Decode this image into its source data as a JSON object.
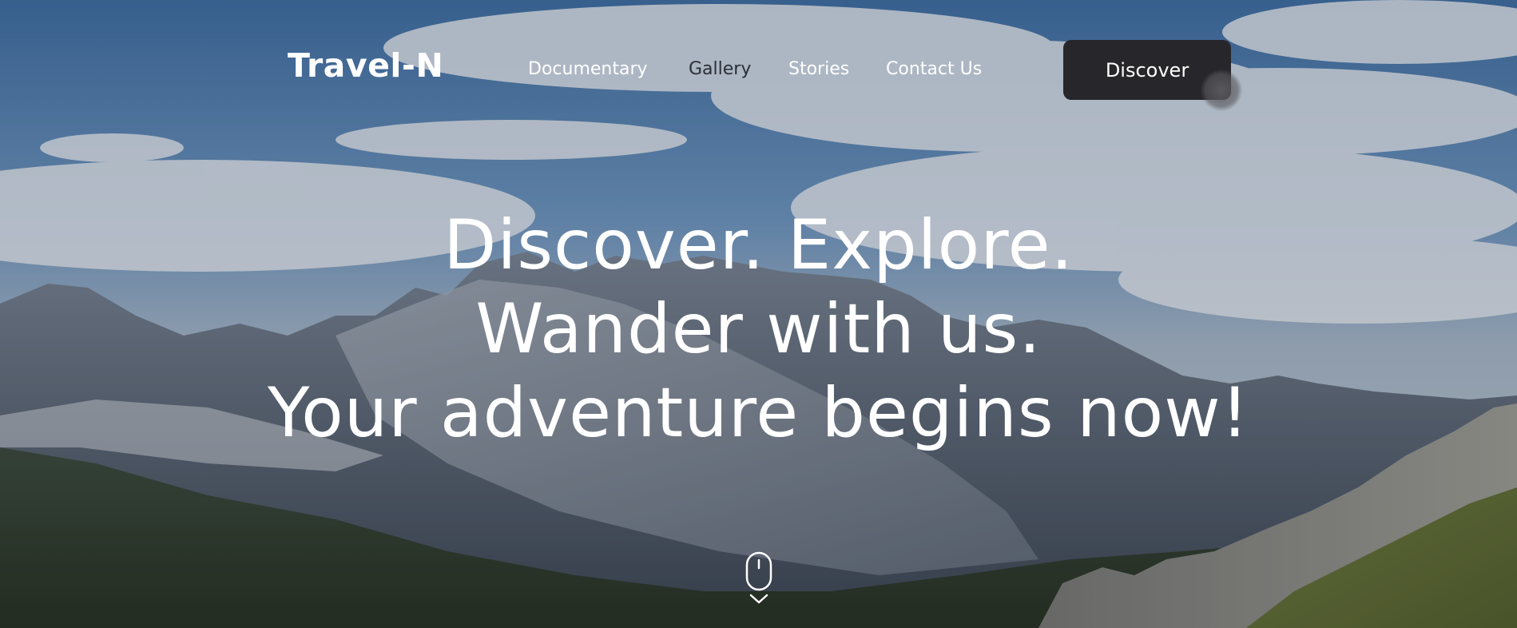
{
  "brand": {
    "logo_text": "Travel-N"
  },
  "nav": {
    "items": [
      {
        "label": "Documentary",
        "active": false
      },
      {
        "label": "Gallery",
        "active": true
      },
      {
        "label": "Stories",
        "active": false
      },
      {
        "label": "Contact Us",
        "active": false
      }
    ],
    "cta_label": "Discover"
  },
  "hero": {
    "lines": [
      "Discover. Explore.",
      "Wander with us.",
      "Your adventure begins now!"
    ],
    "background": "mountain-landscape-image",
    "scroll_icon": "mouse-scroll-icon"
  },
  "colors": {
    "cta_background": "#27272b",
    "text_primary": "#ffffff",
    "nav_active": "#2b2f36"
  }
}
